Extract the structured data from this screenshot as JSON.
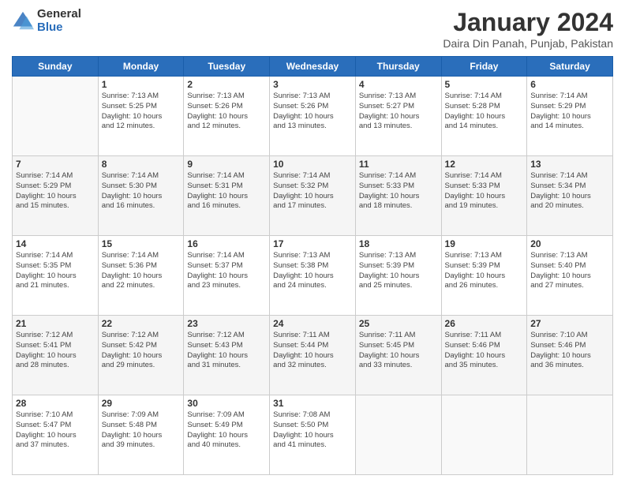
{
  "logo": {
    "general": "General",
    "blue": "Blue"
  },
  "title": "January 2024",
  "location": "Daira Din Panah, Punjab, Pakistan",
  "headers": [
    "Sunday",
    "Monday",
    "Tuesday",
    "Wednesday",
    "Thursday",
    "Friday",
    "Saturday"
  ],
  "weeks": [
    [
      {
        "num": "",
        "info": ""
      },
      {
        "num": "1",
        "info": "Sunrise: 7:13 AM\nSunset: 5:25 PM\nDaylight: 10 hours\nand 12 minutes."
      },
      {
        "num": "2",
        "info": "Sunrise: 7:13 AM\nSunset: 5:26 PM\nDaylight: 10 hours\nand 12 minutes."
      },
      {
        "num": "3",
        "info": "Sunrise: 7:13 AM\nSunset: 5:26 PM\nDaylight: 10 hours\nand 13 minutes."
      },
      {
        "num": "4",
        "info": "Sunrise: 7:13 AM\nSunset: 5:27 PM\nDaylight: 10 hours\nand 13 minutes."
      },
      {
        "num": "5",
        "info": "Sunrise: 7:14 AM\nSunset: 5:28 PM\nDaylight: 10 hours\nand 14 minutes."
      },
      {
        "num": "6",
        "info": "Sunrise: 7:14 AM\nSunset: 5:29 PM\nDaylight: 10 hours\nand 14 minutes."
      }
    ],
    [
      {
        "num": "7",
        "info": "Sunrise: 7:14 AM\nSunset: 5:29 PM\nDaylight: 10 hours\nand 15 minutes."
      },
      {
        "num": "8",
        "info": "Sunrise: 7:14 AM\nSunset: 5:30 PM\nDaylight: 10 hours\nand 16 minutes."
      },
      {
        "num": "9",
        "info": "Sunrise: 7:14 AM\nSunset: 5:31 PM\nDaylight: 10 hours\nand 16 minutes."
      },
      {
        "num": "10",
        "info": "Sunrise: 7:14 AM\nSunset: 5:32 PM\nDaylight: 10 hours\nand 17 minutes."
      },
      {
        "num": "11",
        "info": "Sunrise: 7:14 AM\nSunset: 5:33 PM\nDaylight: 10 hours\nand 18 minutes."
      },
      {
        "num": "12",
        "info": "Sunrise: 7:14 AM\nSunset: 5:33 PM\nDaylight: 10 hours\nand 19 minutes."
      },
      {
        "num": "13",
        "info": "Sunrise: 7:14 AM\nSunset: 5:34 PM\nDaylight: 10 hours\nand 20 minutes."
      }
    ],
    [
      {
        "num": "14",
        "info": "Sunrise: 7:14 AM\nSunset: 5:35 PM\nDaylight: 10 hours\nand 21 minutes."
      },
      {
        "num": "15",
        "info": "Sunrise: 7:14 AM\nSunset: 5:36 PM\nDaylight: 10 hours\nand 22 minutes."
      },
      {
        "num": "16",
        "info": "Sunrise: 7:14 AM\nSunset: 5:37 PM\nDaylight: 10 hours\nand 23 minutes."
      },
      {
        "num": "17",
        "info": "Sunrise: 7:13 AM\nSunset: 5:38 PM\nDaylight: 10 hours\nand 24 minutes."
      },
      {
        "num": "18",
        "info": "Sunrise: 7:13 AM\nSunset: 5:39 PM\nDaylight: 10 hours\nand 25 minutes."
      },
      {
        "num": "19",
        "info": "Sunrise: 7:13 AM\nSunset: 5:39 PM\nDaylight: 10 hours\nand 26 minutes."
      },
      {
        "num": "20",
        "info": "Sunrise: 7:13 AM\nSunset: 5:40 PM\nDaylight: 10 hours\nand 27 minutes."
      }
    ],
    [
      {
        "num": "21",
        "info": "Sunrise: 7:12 AM\nSunset: 5:41 PM\nDaylight: 10 hours\nand 28 minutes."
      },
      {
        "num": "22",
        "info": "Sunrise: 7:12 AM\nSunset: 5:42 PM\nDaylight: 10 hours\nand 29 minutes."
      },
      {
        "num": "23",
        "info": "Sunrise: 7:12 AM\nSunset: 5:43 PM\nDaylight: 10 hours\nand 31 minutes."
      },
      {
        "num": "24",
        "info": "Sunrise: 7:11 AM\nSunset: 5:44 PM\nDaylight: 10 hours\nand 32 minutes."
      },
      {
        "num": "25",
        "info": "Sunrise: 7:11 AM\nSunset: 5:45 PM\nDaylight: 10 hours\nand 33 minutes."
      },
      {
        "num": "26",
        "info": "Sunrise: 7:11 AM\nSunset: 5:46 PM\nDaylight: 10 hours\nand 35 minutes."
      },
      {
        "num": "27",
        "info": "Sunrise: 7:10 AM\nSunset: 5:46 PM\nDaylight: 10 hours\nand 36 minutes."
      }
    ],
    [
      {
        "num": "28",
        "info": "Sunrise: 7:10 AM\nSunset: 5:47 PM\nDaylight: 10 hours\nand 37 minutes."
      },
      {
        "num": "29",
        "info": "Sunrise: 7:09 AM\nSunset: 5:48 PM\nDaylight: 10 hours\nand 39 minutes."
      },
      {
        "num": "30",
        "info": "Sunrise: 7:09 AM\nSunset: 5:49 PM\nDaylight: 10 hours\nand 40 minutes."
      },
      {
        "num": "31",
        "info": "Sunrise: 7:08 AM\nSunset: 5:50 PM\nDaylight: 10 hours\nand 41 minutes."
      },
      {
        "num": "",
        "info": ""
      },
      {
        "num": "",
        "info": ""
      },
      {
        "num": "",
        "info": ""
      }
    ]
  ]
}
